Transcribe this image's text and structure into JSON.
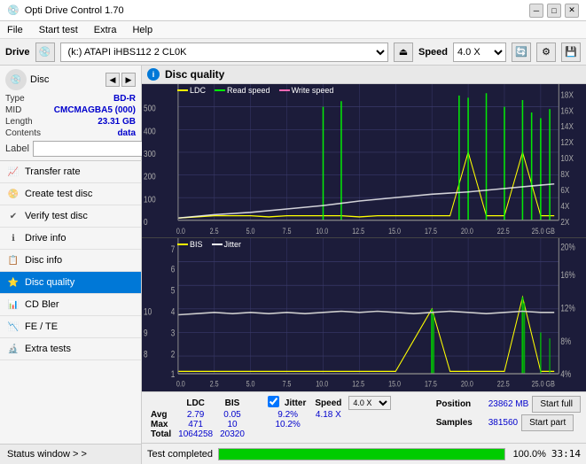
{
  "titlebar": {
    "title": "Opti Drive Control 1.70",
    "icon": "💿",
    "minimize": "─",
    "maximize": "□",
    "close": "✕"
  },
  "menu": {
    "items": [
      "File",
      "Start test",
      "Extra",
      "Help"
    ]
  },
  "drivebar": {
    "label": "Drive",
    "drive_value": "(k:) ATAPI iHBS112  2 CL0K",
    "eject_icon": "⏏",
    "speed_label": "Speed",
    "speed_value": "4.0 X",
    "btn1": "🔄",
    "btn2": "⚙",
    "btn3": "💾"
  },
  "disc": {
    "header": "Disc",
    "type_label": "Type",
    "type_val": "BD-R",
    "mid_label": "MID",
    "mid_val": "CMCMAGBA5 (000)",
    "length_label": "Length",
    "length_val": "23.31 GB",
    "contents_label": "Contents",
    "contents_val": "data",
    "label_label": "Label",
    "label_placeholder": ""
  },
  "nav": {
    "items": [
      {
        "label": "Transfer rate",
        "icon": "📈",
        "active": false
      },
      {
        "label": "Create test disc",
        "icon": "📀",
        "active": false
      },
      {
        "label": "Verify test disc",
        "icon": "✔",
        "active": false
      },
      {
        "label": "Drive info",
        "icon": "ℹ",
        "active": false
      },
      {
        "label": "Disc info",
        "icon": "📋",
        "active": false
      },
      {
        "label": "Disc quality",
        "icon": "⭐",
        "active": true
      },
      {
        "label": "CD Bler",
        "icon": "📊",
        "active": false
      },
      {
        "label": "FE / TE",
        "icon": "📉",
        "active": false
      },
      {
        "label": "Extra tests",
        "icon": "🔬",
        "active": false
      }
    ],
    "status_window": "Status window > >"
  },
  "disc_quality": {
    "title": "Disc quality",
    "legend_top": [
      {
        "label": "LDC",
        "color": "#ffff00"
      },
      {
        "label": "Read speed",
        "color": "#00ff00"
      },
      {
        "label": "Write speed",
        "color": "#ff69b4"
      }
    ],
    "legend_bottom": [
      {
        "label": "BIS",
        "color": "#ffff00"
      },
      {
        "label": "Jitter",
        "color": "#ffffff"
      }
    ],
    "y_top_left": [
      "500",
      "400",
      "300",
      "200",
      "100"
    ],
    "y_top_right": [
      "18X",
      "16X",
      "14X",
      "12X",
      "10X",
      "8X",
      "6X",
      "4X",
      "2X"
    ],
    "x_labels": [
      "0.0",
      "2.5",
      "5.0",
      "7.5",
      "10.0",
      "12.5",
      "15.0",
      "17.5",
      "20.0",
      "22.5",
      "25.0 GB"
    ],
    "y_bottom_left": [
      "10",
      "9",
      "8",
      "7",
      "6",
      "5",
      "4",
      "3",
      "2",
      "1"
    ],
    "y_bottom_right": [
      "20%",
      "16%",
      "12%",
      "8%",
      "4%"
    ]
  },
  "stats": {
    "headers": [
      "",
      "LDC",
      "BIS",
      "",
      "Jitter",
      "Speed",
      "",
      ""
    ],
    "avg_label": "Avg",
    "avg_ldc": "2.79",
    "avg_bis": "0.05",
    "avg_jitter": "9.2%",
    "avg_speed": "4.18 X",
    "max_label": "Max",
    "max_ldc": "471",
    "max_bis": "10",
    "max_jitter": "10.2%",
    "speed_select": "4.0 X",
    "total_label": "Total",
    "total_ldc": "1064258",
    "total_bis": "20320",
    "position_label": "Position",
    "position_val": "23862 MB",
    "samples_label": "Samples",
    "samples_val": "381560",
    "jitter_checked": true,
    "jitter_label": "Jitter",
    "start_full": "Start full",
    "start_part": "Start part"
  },
  "bottom": {
    "status": "Test completed",
    "progress": 100,
    "progress_pct": "100.0%",
    "time": "33:14"
  }
}
